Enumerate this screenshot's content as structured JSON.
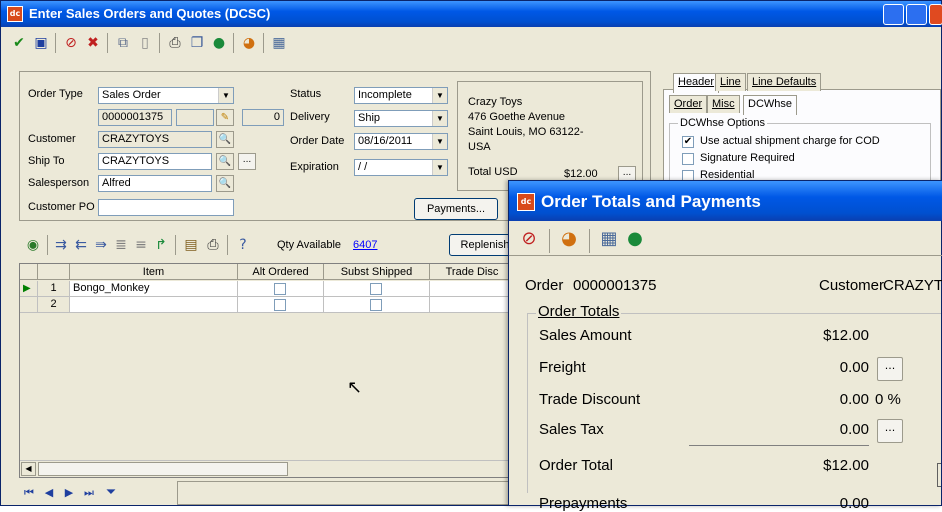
{
  "window": {
    "title": "Enter Sales Orders and Quotes (DCSC)",
    "app_icon": "dc"
  },
  "toolbar": {
    "icons": [
      "check-icon",
      "save-icon",
      "cancel-icon",
      "delete-icon",
      "copy-icon",
      "blank-icon",
      "print-icon",
      "copy-pages-icon",
      "help-icon",
      "chart-icon",
      "calculator-icon"
    ]
  },
  "order": {
    "type_label": "Order Type",
    "type_value": "Sales Order",
    "number_value": "0000001375",
    "number_small": "0",
    "customer_label": "Customer",
    "customer_value": "CRAZYTOYS",
    "shipto_label": "Ship To",
    "shipto_value": "CRAZYTOYS",
    "salesperson_label": "Salesperson",
    "salesperson_value": "Alfred",
    "customerpo_label": "Customer PO",
    "customerpo_value": "",
    "status_label": "Status",
    "status_value": "Incomplete",
    "delivery_label": "Delivery",
    "delivery_value": "Ship",
    "orderdate_label": "Order Date",
    "orderdate_value": "08/16/2011",
    "expiration_label": "Expiration",
    "expiration_value": " / /",
    "payments_button": "Payments...",
    "more_button": "..."
  },
  "address": {
    "line1": "Crazy Toys",
    "line2": "476 Goethe Avenue",
    "line3": "Saint Louis, MO  63122-",
    "line4": "USA",
    "total_label": "Total USD",
    "total_value": "$12.00"
  },
  "tabs": {
    "row1": [
      "Header",
      "Line",
      "Line Defaults"
    ],
    "row2": [
      "Order",
      "Misc",
      "DCWhse"
    ],
    "group_title": "DCWhse Options",
    "options": [
      {
        "label": "Use actual shipment charge for COD",
        "checked": true
      },
      {
        "label": "Signature Required",
        "checked": false
      },
      {
        "label": "Residential",
        "checked": false
      }
    ]
  },
  "lines_toolbar": {
    "qty_available_label": "Qty Available",
    "qty_available_value": "6407",
    "replenish_button": "Replenish"
  },
  "grid": {
    "headers": [
      "Item",
      "Alt Ordered",
      "Subst Shipped",
      "Trade Disc"
    ],
    "rows": [
      {
        "num": "1",
        "item": "Bongo_Monkey"
      },
      {
        "num": "2",
        "item": ""
      }
    ]
  },
  "dialog": {
    "title": "Order Totals and Payments",
    "order_label": "Order",
    "order_value": "0000001375",
    "customer_label": "Customer",
    "customer_value": "CRAZYT",
    "group_title": "Order Totals",
    "sales_amount_label": "Sales Amount",
    "sales_amount_value": "$12.00",
    "freight_label": "Freight",
    "freight_value": "0.00",
    "trade_discount_label": "Trade Discount",
    "trade_discount_value": "0.00",
    "trade_discount_pct": "0 %",
    "sales_tax_label": "Sales Tax",
    "sales_tax_value": "0.00",
    "order_total_label": "Order Total",
    "order_total_value": "$12.00",
    "prepayments_label": "Prepayments",
    "prepayments_value": "0.00",
    "button_label": "..."
  },
  "colors": {
    "title_blue": "#0058e6",
    "face": "#ece9d8",
    "link_blue": "#0000ff"
  }
}
